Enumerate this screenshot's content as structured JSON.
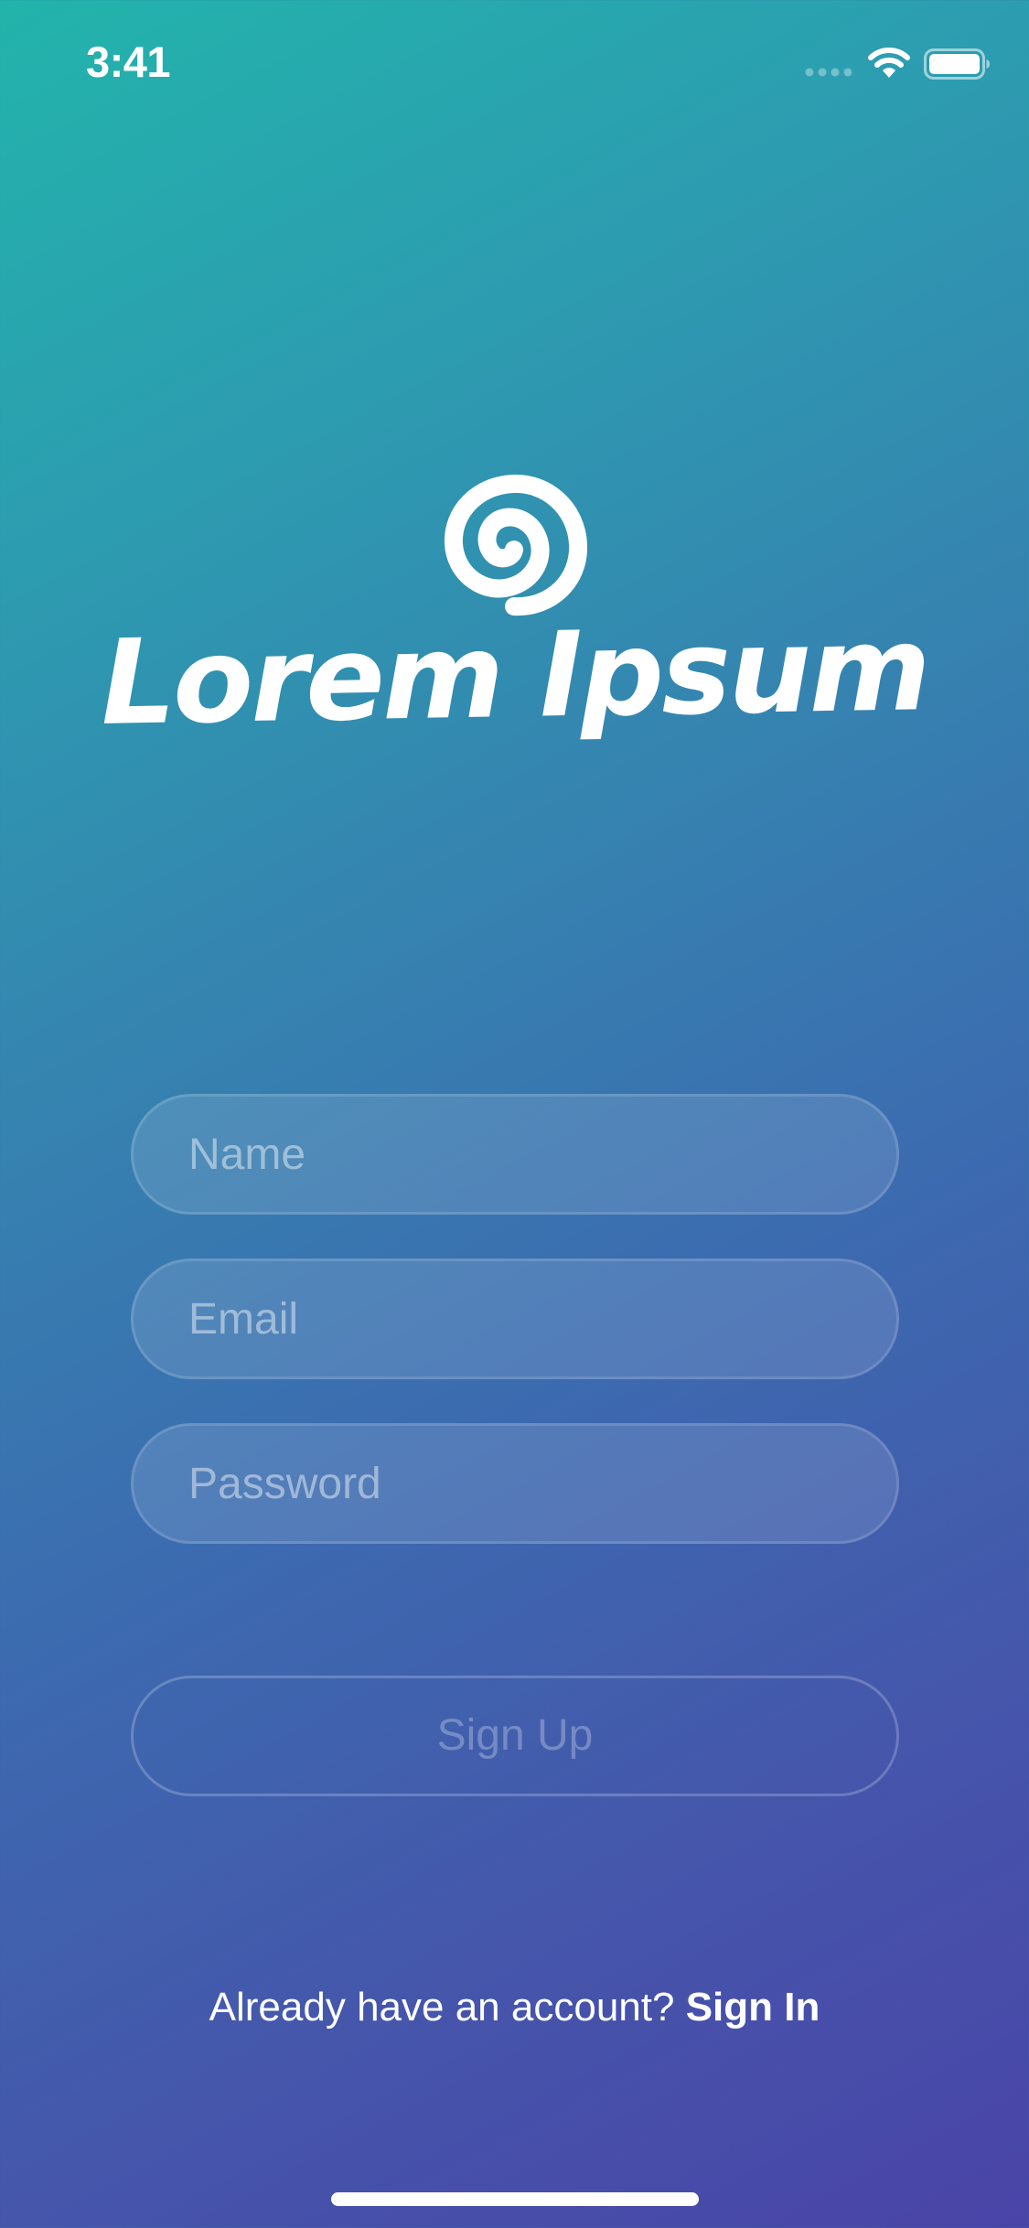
{
  "status_bar": {
    "time": "3:41",
    "icons": [
      "signal-icon",
      "wifi-icon",
      "battery-icon"
    ]
  },
  "logo": {
    "icon": "spiral-icon",
    "text": "Lorem Ipsum"
  },
  "form": {
    "name_placeholder": "Name",
    "email_placeholder": "Email",
    "password_placeholder": "Password",
    "submit_label": "Sign Up"
  },
  "footer": {
    "prompt": "Already have an account?",
    "link": "Sign In"
  },
  "colors": {
    "gradient_start": "#22b4ab",
    "gradient_end": "#4a44a8",
    "text": "#ffffff"
  }
}
